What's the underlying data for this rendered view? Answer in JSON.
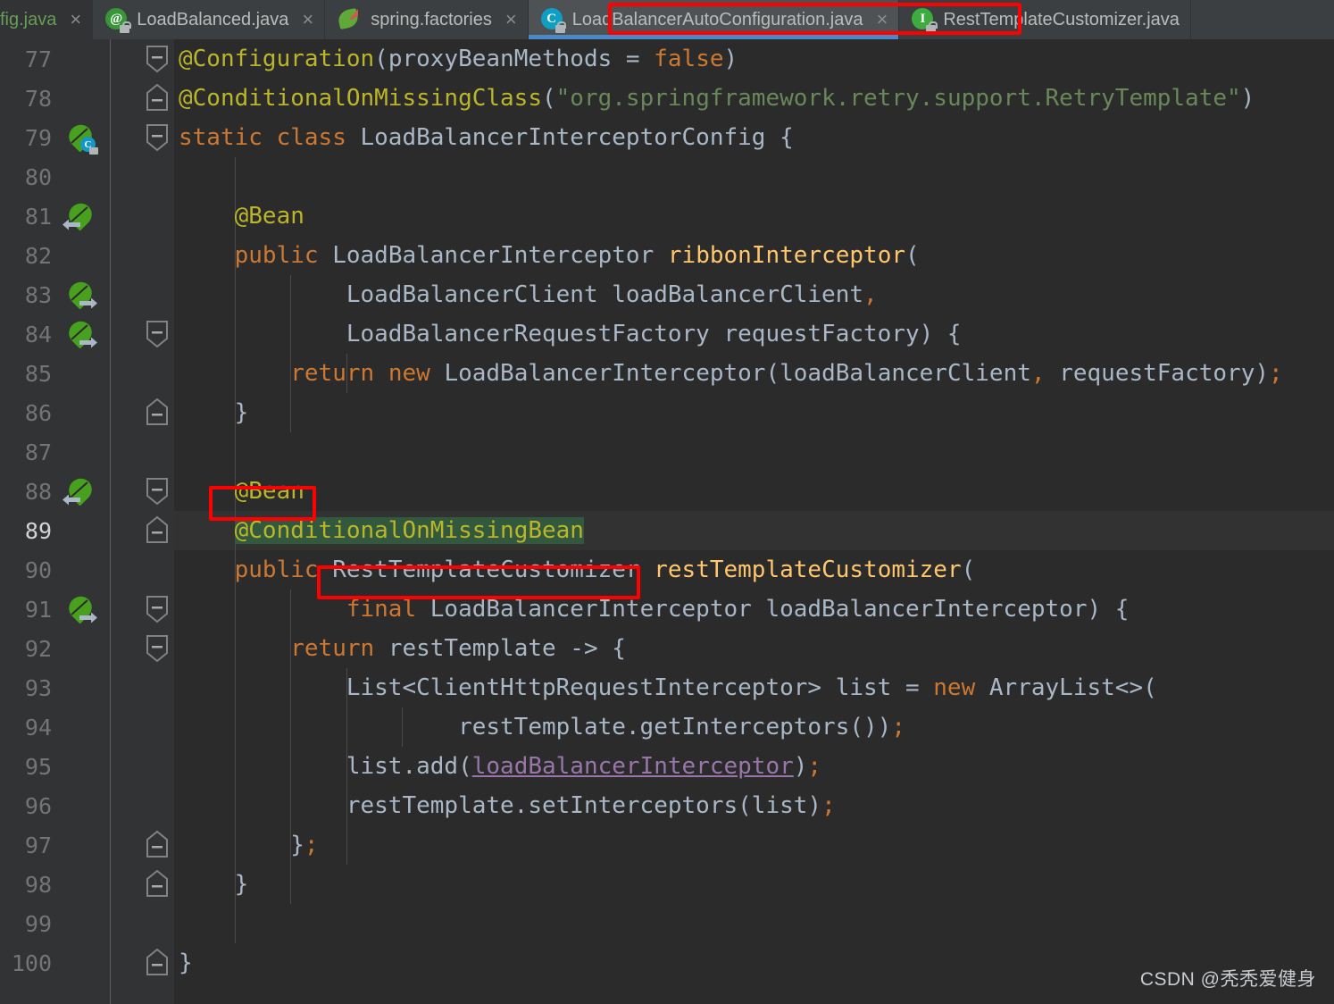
{
  "tabs": [
    {
      "label": "fig.java",
      "icon": "at-annotation-icon",
      "color_style": "green",
      "state": "truncated-left",
      "close": "×"
    },
    {
      "label": "LoadBalanced.java",
      "icon": "at-annotation-icon",
      "color_style": "gray",
      "state": "inactive",
      "close": "×"
    },
    {
      "label": "spring.factories",
      "icon": "spring-leaf-icon",
      "color_style": "gray",
      "state": "inactive",
      "close": "×"
    },
    {
      "label": "LoadBalancerAutoConfiguration.java",
      "icon": "java-class-icon",
      "color_style": "gray",
      "state": "active",
      "close": "×"
    },
    {
      "label": "RestTemplateCustomizer.java",
      "icon": "java-interface-icon",
      "color_style": "gray",
      "state": "inactive",
      "close": ""
    }
  ],
  "icon_glyphs": {
    "at": "@",
    "class": "C",
    "interface": "I"
  },
  "colors": {
    "tab_active_underline": "#4a88c7",
    "annotation": "#bbb529",
    "keyword": "#cc7832",
    "string": "#6a8759",
    "method": "#ffc66d",
    "field": "#9876aa",
    "plain": "#a9b7c6",
    "editor_bg": "#2b2b2b",
    "gutter_bg": "#313335",
    "current_line_bg": "#323232",
    "search_highlight": "#32593d",
    "annotation_box": "#fe0000"
  },
  "editor": {
    "current_line": 89,
    "lines": [
      {
        "n": 77,
        "indent": 0,
        "fold": "collapse-down",
        "bean": null,
        "segs": [
          {
            "t": "@Configuration",
            "c": "anno"
          },
          {
            "t": "(",
            "c": "pl"
          },
          {
            "t": "proxyBeanMethods ",
            "c": "pl"
          },
          {
            "t": "= ",
            "c": "pl"
          },
          {
            "t": "false",
            "c": "kw"
          },
          {
            "t": ")",
            "c": "pl"
          }
        ]
      },
      {
        "n": 78,
        "indent": 0,
        "fold": "collapse-up",
        "bean": null,
        "segs": [
          {
            "t": "@ConditionalOnMissingClass",
            "c": "anno"
          },
          {
            "t": "(",
            "c": "pl"
          },
          {
            "t": "\"org.springframework.retry.support.RetryTemplate\"",
            "c": "str"
          },
          {
            "t": ")",
            "c": "pl"
          }
        ]
      },
      {
        "n": 79,
        "indent": 0,
        "fold": "collapse-down",
        "bean": "class",
        "segs": [
          {
            "t": "static ",
            "c": "kw"
          },
          {
            "t": "class ",
            "c": "kw"
          },
          {
            "t": "LoadBalancerInterceptorConfig {",
            "c": "pl"
          }
        ]
      },
      {
        "n": 80,
        "indent": 1,
        "fold": null,
        "bean": null,
        "segs": []
      },
      {
        "n": 81,
        "indent": 1,
        "fold": null,
        "bean": "left",
        "segs": [
          {
            "t": "    @Bean",
            "c": "anno"
          }
        ]
      },
      {
        "n": 82,
        "indent": 1,
        "fold": null,
        "bean": null,
        "segs": [
          {
            "t": "    ",
            "c": "pl"
          },
          {
            "t": "public ",
            "c": "kw"
          },
          {
            "t": "LoadBalancerInterceptor ",
            "c": "pl"
          },
          {
            "t": "ribbonInterceptor",
            "c": "mth"
          },
          {
            "t": "(",
            "c": "pl"
          }
        ]
      },
      {
        "n": 83,
        "indent": 2,
        "fold": null,
        "bean": "right",
        "segs": [
          {
            "t": "            LoadBalancerClient loadBalancerClient",
            "c": "pl"
          },
          {
            "t": ",",
            "c": "kw"
          }
        ]
      },
      {
        "n": 84,
        "indent": 2,
        "fold": "collapse-down",
        "bean": "right",
        "segs": [
          {
            "t": "            LoadBalancerRequestFactory requestFactory) {",
            "c": "pl"
          }
        ]
      },
      {
        "n": 85,
        "indent": 3,
        "fold": null,
        "bean": null,
        "segs": [
          {
            "t": "        ",
            "c": "pl"
          },
          {
            "t": "return ",
            "c": "kw"
          },
          {
            "t": "new ",
            "c": "kw"
          },
          {
            "t": "LoadBalancerInterceptor(loadBalancerClient",
            "c": "pl"
          },
          {
            "t": ",",
            "c": "kw"
          },
          {
            "t": " requestFactory)",
            "c": "pl"
          },
          {
            "t": ";",
            "c": "kw"
          }
        ]
      },
      {
        "n": 86,
        "indent": 2,
        "fold": "collapse-up",
        "bean": null,
        "segs": [
          {
            "t": "    }",
            "c": "pl"
          }
        ]
      },
      {
        "n": 87,
        "indent": 1,
        "fold": null,
        "bean": null,
        "segs": []
      },
      {
        "n": 88,
        "indent": 1,
        "fold": "collapse-down",
        "bean": "left",
        "segs": [
          {
            "t": "    @Bean",
            "c": "anno"
          }
        ]
      },
      {
        "n": 89,
        "indent": 1,
        "fold": "collapse-up",
        "bean": null,
        "segs": [
          {
            "t": "    ",
            "c": "pl"
          },
          {
            "t": "@ConditionalOnMissingBean",
            "c": "anno",
            "hl": true
          }
        ]
      },
      {
        "n": 90,
        "indent": 1,
        "fold": null,
        "bean": null,
        "segs": [
          {
            "t": "    ",
            "c": "pl"
          },
          {
            "t": "public ",
            "c": "kw"
          },
          {
            "t": "RestTemplateCustomizer ",
            "c": "pl"
          },
          {
            "t": "restTemplateCustomizer",
            "c": "mth"
          },
          {
            "t": "(",
            "c": "pl"
          }
        ]
      },
      {
        "n": 91,
        "indent": 2,
        "fold": "collapse-down",
        "bean": "right",
        "segs": [
          {
            "t": "            ",
            "c": "pl"
          },
          {
            "t": "final ",
            "c": "kw"
          },
          {
            "t": "LoadBalancerInterceptor loadBalancerInterceptor) {",
            "c": "pl"
          }
        ]
      },
      {
        "n": 92,
        "indent": 2,
        "fold": "collapse-down",
        "bean": null,
        "segs": [
          {
            "t": "        ",
            "c": "pl"
          },
          {
            "t": "return ",
            "c": "kw"
          },
          {
            "t": "restTemplate -> {",
            "c": "pl"
          }
        ]
      },
      {
        "n": 93,
        "indent": 3,
        "fold": null,
        "bean": null,
        "segs": [
          {
            "t": "            List<ClientHttpRequestInterceptor> list = ",
            "c": "pl"
          },
          {
            "t": "new ",
            "c": "kw"
          },
          {
            "t": "ArrayList<>(",
            "c": "pl"
          }
        ]
      },
      {
        "n": 94,
        "indent": 4,
        "fold": null,
        "bean": null,
        "segs": [
          {
            "t": "                    restTemplate.getInterceptors())",
            "c": "pl"
          },
          {
            "t": ";",
            "c": "kw"
          }
        ]
      },
      {
        "n": 95,
        "indent": 3,
        "fold": null,
        "bean": null,
        "segs": [
          {
            "t": "            list.add(",
            "c": "pl"
          },
          {
            "t": "loadBalancerInterceptor",
            "c": "fld"
          },
          {
            "t": ")",
            "c": "pl"
          },
          {
            "t": ";",
            "c": "kw"
          }
        ]
      },
      {
        "n": 96,
        "indent": 3,
        "fold": null,
        "bean": null,
        "segs": [
          {
            "t": "            restTemplate.setInterceptors(list)",
            "c": "pl"
          },
          {
            "t": ";",
            "c": "kw"
          }
        ]
      },
      {
        "n": 97,
        "indent": 3,
        "fold": "collapse-up",
        "bean": null,
        "segs": [
          {
            "t": "        }",
            "c": "pl"
          },
          {
            "t": ";",
            "c": "kw"
          }
        ]
      },
      {
        "n": 98,
        "indent": 2,
        "fold": "collapse-up",
        "bean": null,
        "segs": [
          {
            "t": "    }",
            "c": "pl"
          }
        ]
      },
      {
        "n": 99,
        "indent": 1,
        "fold": null,
        "bean": null,
        "segs": []
      },
      {
        "n": 100,
        "indent": 0,
        "fold": "collapse-up",
        "bean": null,
        "segs": [
          {
            "t": "}",
            "c": "pl"
          }
        ]
      }
    ]
  },
  "annotations": {
    "boxes": [
      {
        "name": "tab-highlight-box",
        "target": "LoadBalancerAutoConfiguration.java"
      },
      {
        "name": "bean-annotation-box",
        "target": "@Bean"
      },
      {
        "name": "resttemplatecustomizer-type-box",
        "target": "RestTemplateCustomizer"
      }
    ]
  },
  "watermark": {
    "text": "CSDN @秃秃爱健身"
  }
}
